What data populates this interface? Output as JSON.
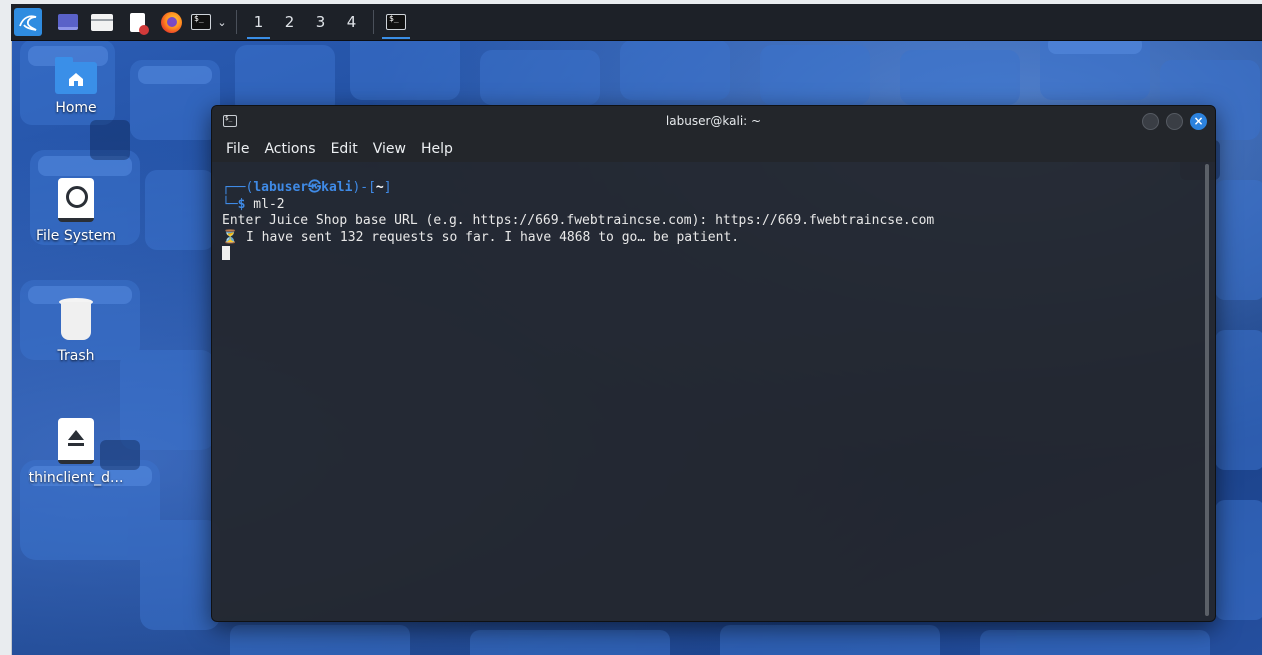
{
  "theme": {
    "panel_bg": "#1d2128",
    "accent": "#3a8ee6",
    "terminal_bg": "#23262b",
    "prompt_blue": "#3f8ae6"
  },
  "taskbar": {
    "launchers": [
      {
        "icon": "kali-menu-icon"
      },
      {
        "icon": "show-desktop-icon"
      },
      {
        "icon": "file-manager-icon"
      },
      {
        "icon": "text-editor-icon"
      },
      {
        "icon": "firefox-icon"
      },
      {
        "icon": "terminal-icon"
      }
    ],
    "workspaces": [
      "1",
      "2",
      "3",
      "4"
    ],
    "active_workspace": "1"
  },
  "desktop": {
    "icons": [
      {
        "label": "Home",
        "icon": "home-folder-icon"
      },
      {
        "label": "File System",
        "icon": "hard-drive-icon"
      },
      {
        "label": "Trash",
        "icon": "trash-icon"
      },
      {
        "label": "thinclient_d...",
        "icon": "eject-drive-icon"
      }
    ]
  },
  "terminal": {
    "title": "labuser@kali: ~",
    "menu": [
      "File",
      "Actions",
      "Edit",
      "View",
      "Help"
    ],
    "prompt": {
      "top_open": "┌──(",
      "user": "labuser",
      "at": "㉿",
      "host": "kali",
      "top_mid": ")-[",
      "cwd": "~",
      "top_close": "]",
      "bottom": "└─",
      "dollar": "$",
      "command": " ml-2"
    },
    "output": [
      "Enter Juice Shop base URL (e.g. https://669.fwebtraincse.com): https://669.fwebtraincse.com",
      "⏳ I have sent 132 requests so far. I have 4868 to go… be patient."
    ]
  }
}
